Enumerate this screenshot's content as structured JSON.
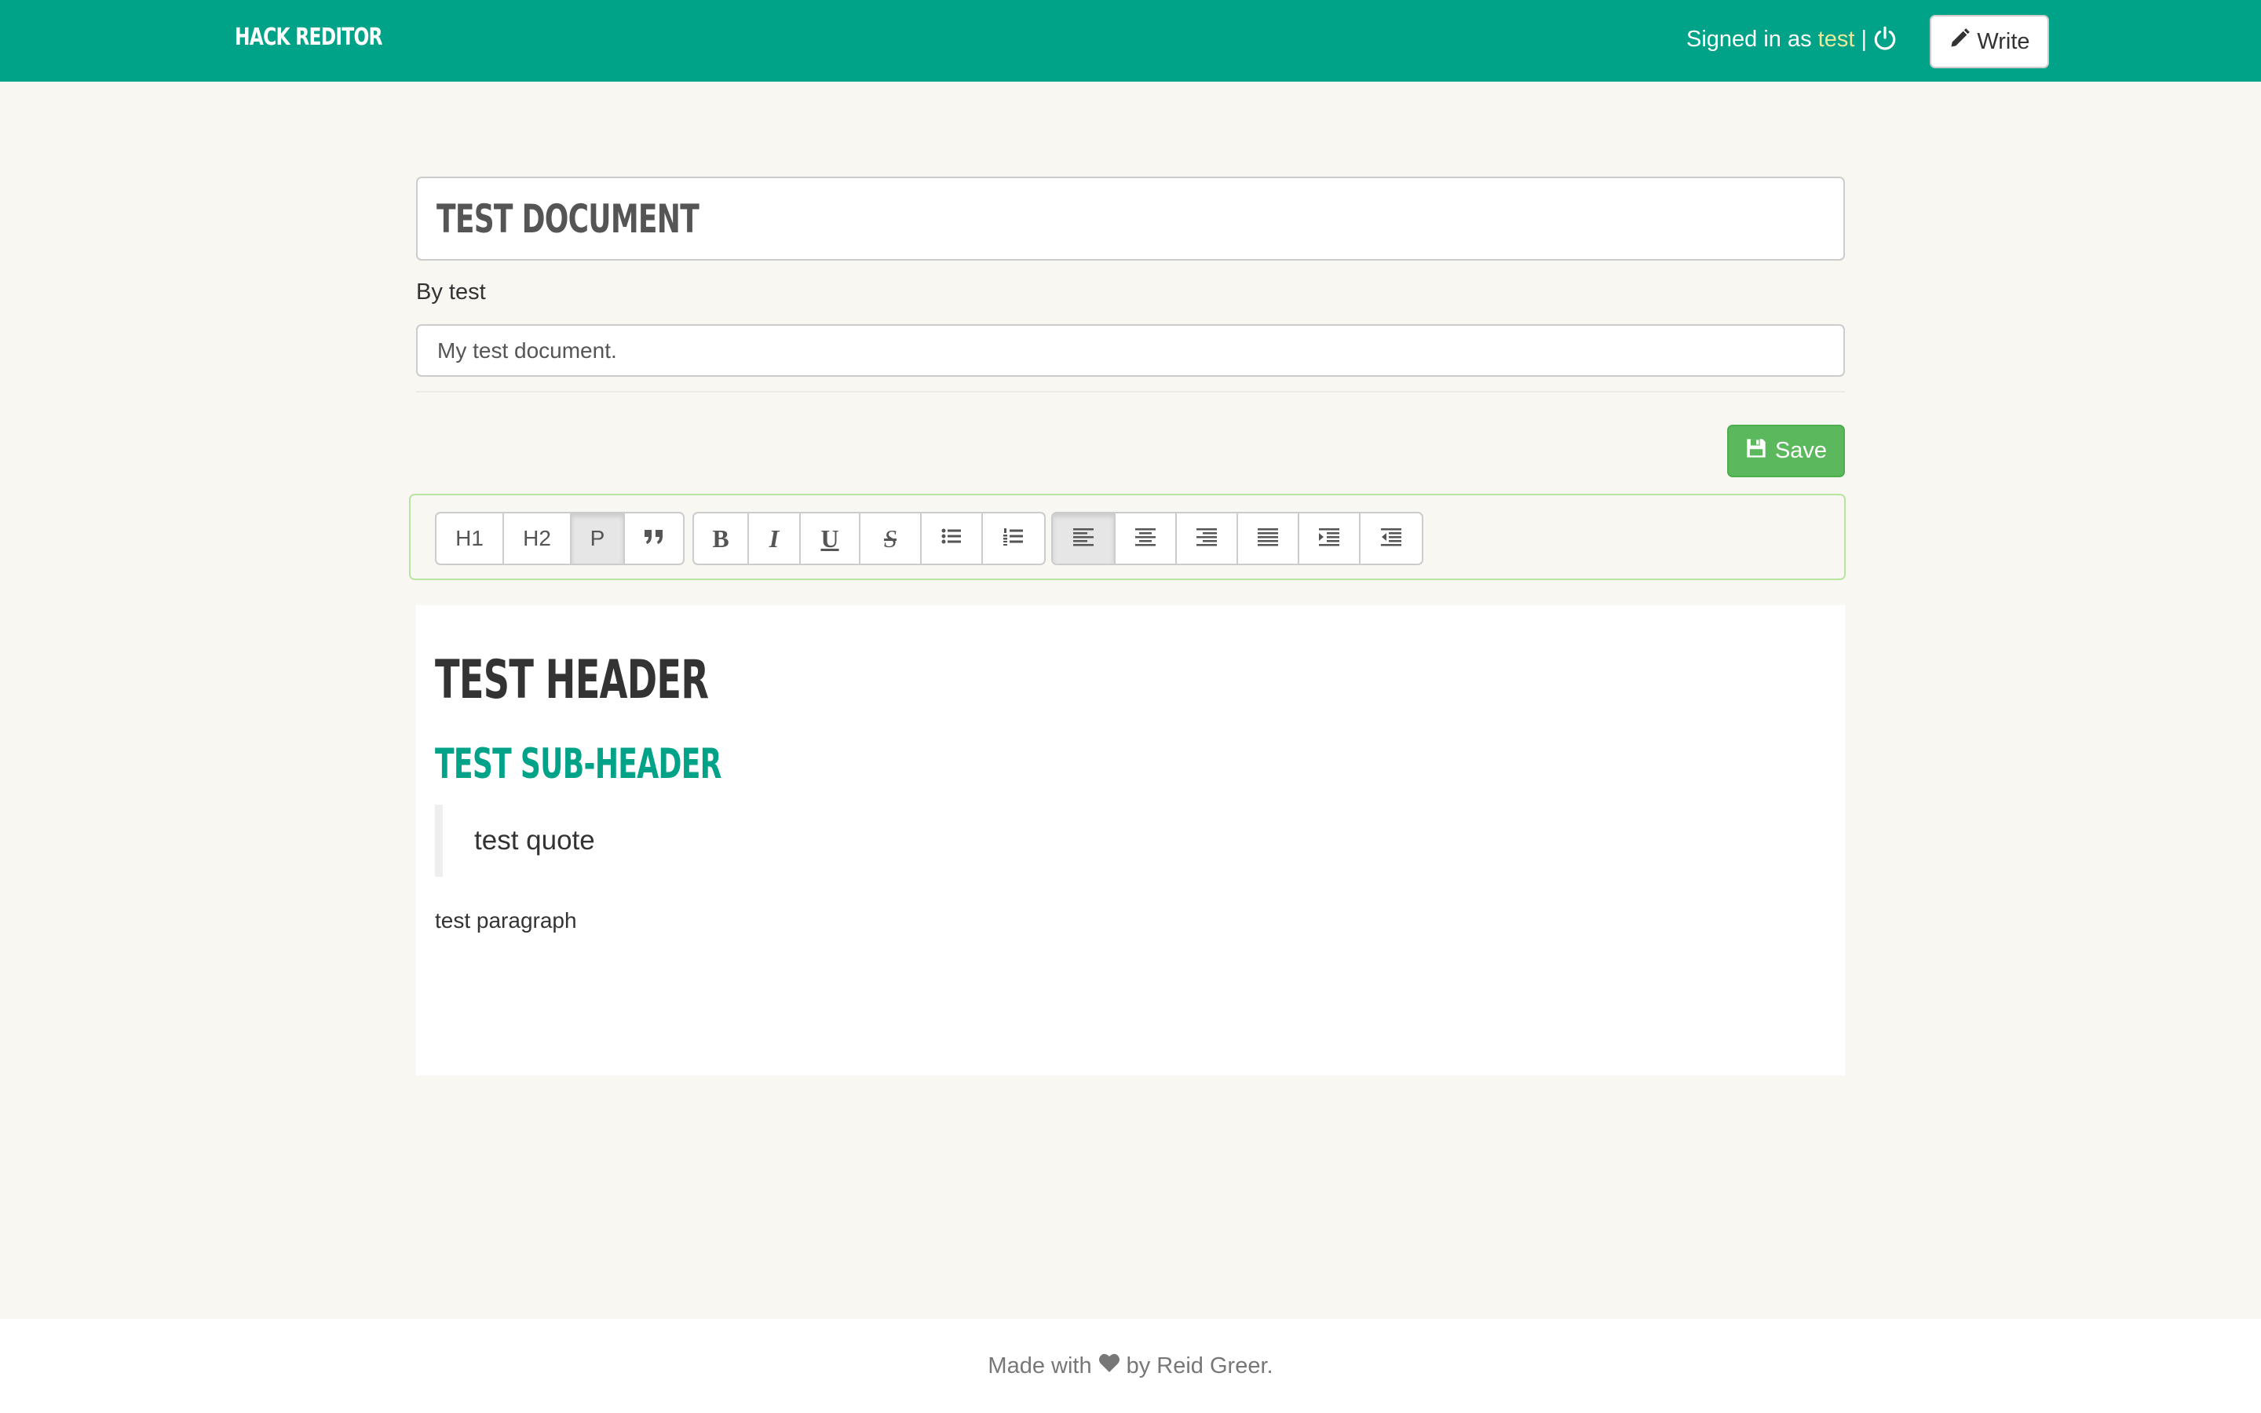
{
  "navbar": {
    "brand": "Hack Reditor",
    "signed_in_prefix": "Signed in as ",
    "username": "test",
    "separator": " |",
    "power_icon": "power-icon",
    "write_label": "Write",
    "write_icon": "pencil-icon",
    "bg_color": "#00a388"
  },
  "document": {
    "title": "Test Document",
    "byline": "By test",
    "description": "My test document.",
    "save_label": "Save",
    "save_icon": "floppy-disk-icon",
    "save_color": "#5cb85c"
  },
  "toolbar": {
    "block_buttons": [
      {
        "label": "H1"
      },
      {
        "label": "H2"
      },
      {
        "label": "P",
        "active": true
      },
      {
        "icon": "quote-icon"
      }
    ],
    "format_buttons": [
      {
        "label": "B",
        "icon": "bold-icon"
      },
      {
        "label": "I",
        "icon": "italic-icon"
      },
      {
        "label": "U",
        "icon": "underline-icon"
      },
      {
        "label": "S",
        "icon": "strikethrough-icon"
      },
      {
        "icon": "bullet-list-icon"
      },
      {
        "icon": "numbered-list-icon"
      }
    ],
    "align_buttons": [
      {
        "icon": "align-left-icon",
        "active": true
      },
      {
        "icon": "align-center-icon"
      },
      {
        "icon": "align-right-icon"
      },
      {
        "icon": "align-justify-icon"
      },
      {
        "icon": "indent-icon"
      },
      {
        "icon": "outdent-icon"
      }
    ]
  },
  "content": {
    "header": "Test Header",
    "subheader": "Test Sub-Header",
    "quote": "test quote",
    "paragraph": "test paragraph",
    "subheader_color": "#00a388"
  },
  "footer": {
    "made_with": "Made with",
    "heart_icon": "heart-icon",
    "by": "by Reid Greer."
  }
}
